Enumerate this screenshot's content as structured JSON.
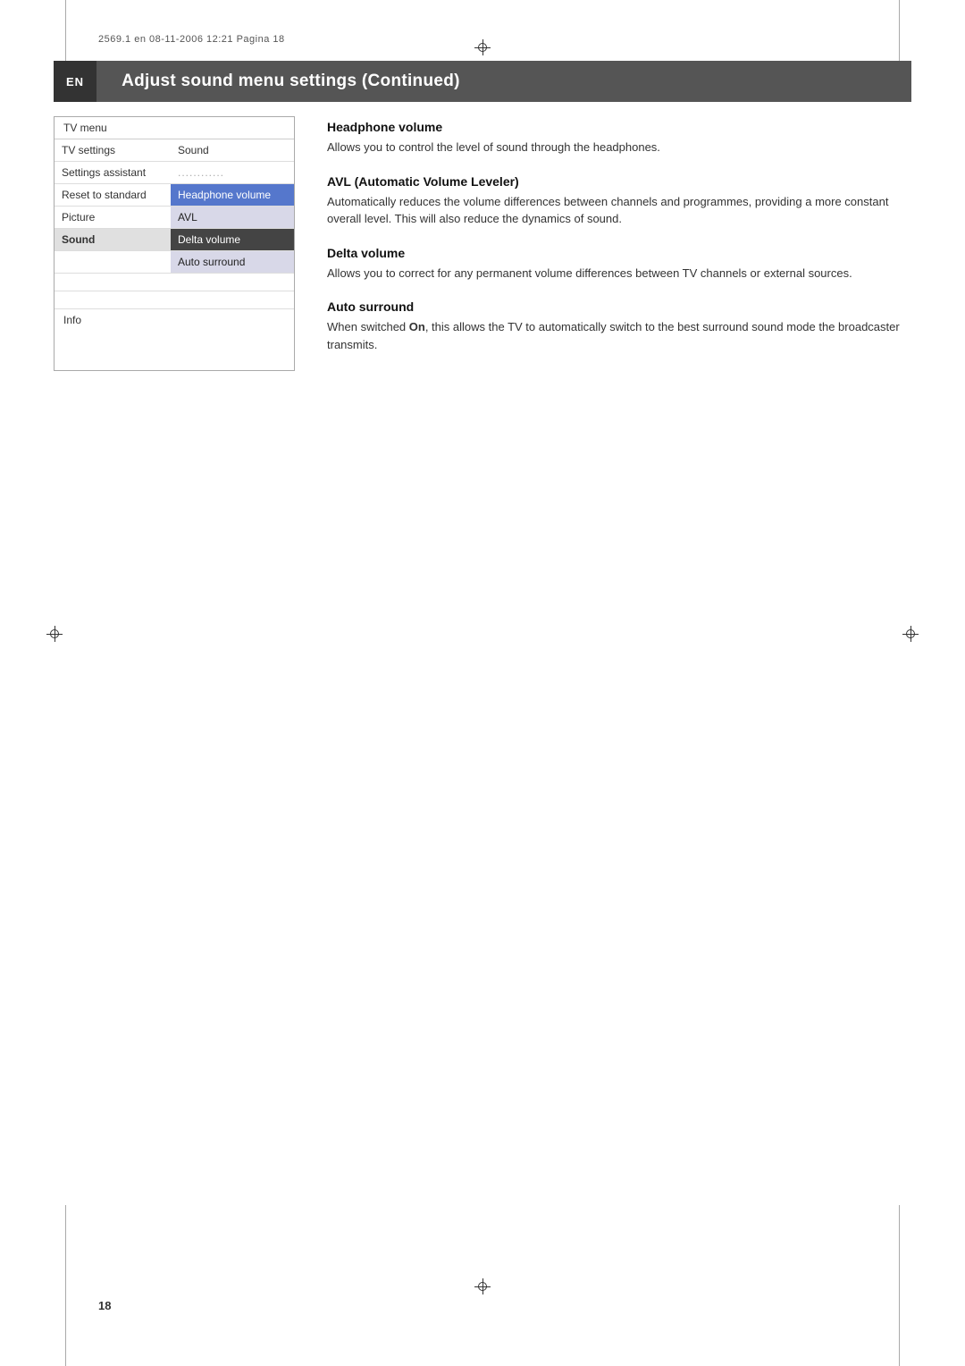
{
  "meta": {
    "line": "2569.1 en  08-11-2006  12:21  Pagina 18"
  },
  "header": {
    "badge": "EN",
    "title": "Adjust sound menu settings  (Continued)"
  },
  "tv_menu": {
    "title": "TV menu",
    "rows": [
      {
        "left": "TV settings",
        "right": "Sound",
        "left_style": "normal",
        "right_style": "normal"
      },
      {
        "left": "Settings assistant",
        "right": "............",
        "left_style": "normal",
        "right_style": "dots"
      },
      {
        "left": "Reset to standard",
        "right": "Headphone volume",
        "left_style": "normal",
        "right_style": "highlighted-blue"
      },
      {
        "left": "Picture",
        "right": "AVL",
        "left_style": "normal",
        "right_style": "light"
      },
      {
        "left": "Sound",
        "right": "Delta volume",
        "left_style": "highlighted",
        "right_style": "dark"
      },
      {
        "left": "",
        "right": "Auto surround",
        "left_style": "normal",
        "right_style": "light"
      },
      {
        "left": "",
        "right": "",
        "left_style": "empty",
        "right_style": "empty"
      },
      {
        "left": "",
        "right": "",
        "left_style": "empty",
        "right_style": "empty"
      }
    ],
    "info": "Info"
  },
  "descriptions": [
    {
      "id": "headphone-volume",
      "title": "Headphone volume",
      "text": "Allows you to control the level of sound through the headphones."
    },
    {
      "id": "avl",
      "title": "AVL (Automatic Volume Leveler)",
      "text": "Automatically reduces the volume differences between channels and programmes, providing a more constant overall level. This will also reduce the dynamics of sound."
    },
    {
      "id": "delta-volume",
      "title": "Delta volume",
      "text": "Allows you to correct for any permanent volume differences between TV channels or external sources."
    },
    {
      "id": "auto-surround",
      "title": "Auto surround",
      "text": "When switched On, this allows the TV to automatically switch to the best surround sound mode the broadcaster transmits."
    }
  ],
  "page_number": "18"
}
